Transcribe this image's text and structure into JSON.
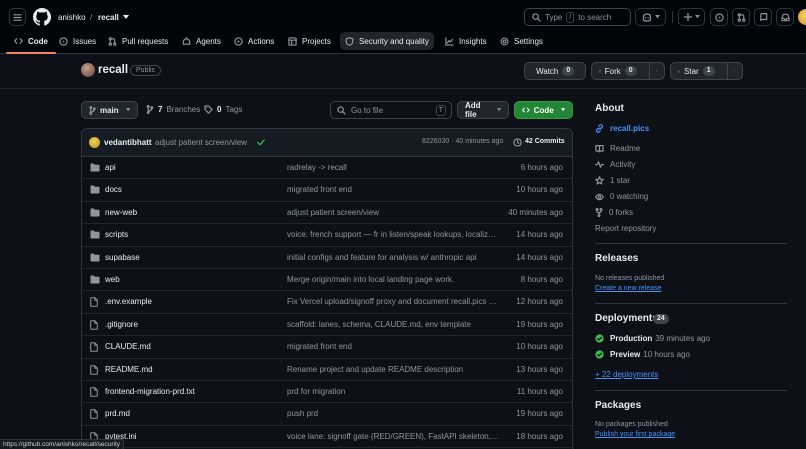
{
  "header": {
    "owner": "anishko",
    "separator": "/",
    "repo": "recall",
    "search_prefix": "Type",
    "search_key": "/",
    "search_suffix": "to search"
  },
  "nav": {
    "tabs": [
      {
        "label": "Code"
      },
      {
        "label": "Issues"
      },
      {
        "label": "Pull requests"
      },
      {
        "label": "Agents"
      },
      {
        "label": "Actions"
      },
      {
        "label": "Projects"
      },
      {
        "label": "Security and quality"
      },
      {
        "label": "Insights"
      },
      {
        "label": "Settings"
      }
    ]
  },
  "repo": {
    "name": "recall",
    "visibility": "Public",
    "watch_label": "Watch",
    "watch_count": "0",
    "fork_label": "Fork",
    "fork_count": "0",
    "star_label": "Star",
    "star_count": "1"
  },
  "toolbar": {
    "branch": "main",
    "branches_count": "7",
    "branches_label": "Branches",
    "tags_count": "0",
    "tags_label": "Tags",
    "goto_placeholder": "Go to file",
    "goto_key": "T",
    "add_file": "Add file",
    "code": "Code"
  },
  "last_commit": {
    "author": "vedantibhatt",
    "message": "adjust patient screen/view",
    "hash_time": "8226030 · 40 minutes ago",
    "commits_label": "42 Commits"
  },
  "files": [
    {
      "name": "api",
      "type": "dir",
      "message": "radrelay -> recall",
      "time": "6 hours ago"
    },
    {
      "name": "docs",
      "type": "dir",
      "message": "migrated front end",
      "time": "10 hours ago"
    },
    {
      "name": "new-web",
      "type": "dir",
      "message": "adjust patient screen/view",
      "time": "40 minutes ago"
    },
    {
      "name": "scripts",
      "type": "dir",
      "message": "voice: french support — fr in listen/speak lookups, localize...",
      "time": "14 hours ago"
    },
    {
      "name": "supabase",
      "type": "dir",
      "message": "initial configs and feature for analysis w/ anthropic api",
      "time": "14 hours ago"
    },
    {
      "name": "web",
      "type": "dir",
      "message": "Merge origin/main into local landing page work.",
      "time": "8 hours ago"
    },
    {
      "name": ".env.example",
      "type": "file",
      "message": "Fix Vercel upload/signoff proxy and document recall.pics +...",
      "time": "12 hours ago"
    },
    {
      "name": ".gitignore",
      "type": "file",
      "message": "scaffold: lanes, schema, CLAUDE.md, env template",
      "time": "19 hours ago"
    },
    {
      "name": "CLAUDE.md",
      "type": "file",
      "message": "migrated front end",
      "time": "10 hours ago"
    },
    {
      "name": "README.md",
      "type": "file",
      "message": "Rename project and update README description",
      "time": "13 hours ago"
    },
    {
      "name": "frontend-migration-prd.txt",
      "type": "file",
      "message": "prd for migration",
      "time": "11 hours ago"
    },
    {
      "name": "prd.md",
      "type": "file",
      "message": "push prd",
      "time": "19 hours ago"
    },
    {
      "name": "pytest.ini",
      "type": "file",
      "message": "voice lane: signoff gate (RED/GREEN), FastAPI skeleton, v...",
      "time": "18 hours ago"
    }
  ],
  "about": {
    "heading": "About",
    "website": "recall.pics",
    "readme": "Readme",
    "activity": "Activity",
    "stars": "1 star",
    "watching": "0 watching",
    "forks": "0 forks",
    "report": "Report repository"
  },
  "releases": {
    "heading": "Releases",
    "empty": "No releases published",
    "create": "Create a new release"
  },
  "deployments": {
    "heading": "Deployments",
    "count": "24",
    "items": [
      {
        "env": "Production",
        "time": "39 minutes ago"
      },
      {
        "env": "Preview",
        "time": "10 hours ago"
      }
    ],
    "more": "+ 22 deployments"
  },
  "packages": {
    "heading": "Packages",
    "empty": "No packages published",
    "publish": "Publish your first package"
  },
  "status_url": "https://github.com/anishko/recall/security",
  "colors": {
    "accent_link": "#4493f8",
    "primary_button": "#238636",
    "selected_tab_underline": "#f78166",
    "success": "#3fb950"
  }
}
